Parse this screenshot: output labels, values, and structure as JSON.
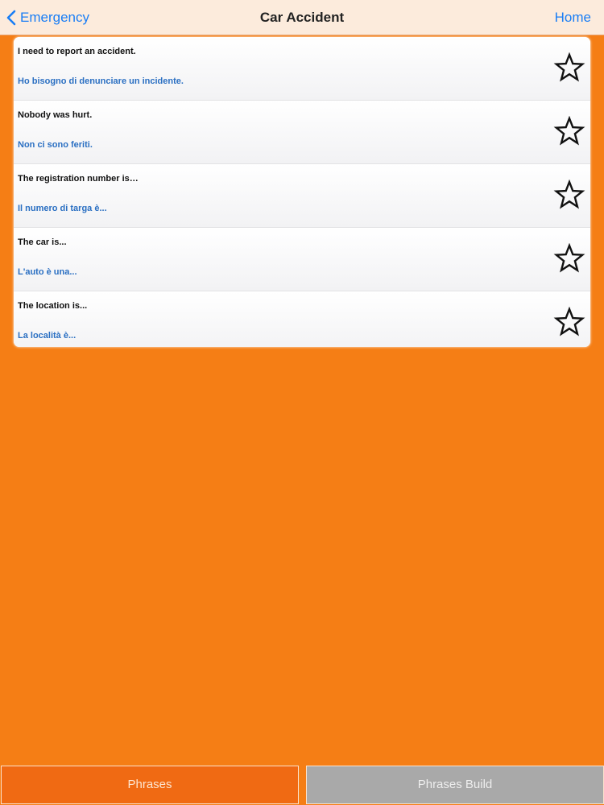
{
  "nav": {
    "back_label": "Emergency",
    "title": "Car Accident",
    "home_label": "Home"
  },
  "phrases": [
    {
      "english": "I need to report an accident.",
      "italian": "Ho bisogno di denunciare un incidente.",
      "starred": false
    },
    {
      "english": "Nobody was hurt.",
      "italian": "Non ci sono feriti.",
      "starred": false
    },
    {
      "english": "The registration number is…",
      "italian": "Il numero di targa è...",
      "starred": false
    },
    {
      "english": "The car is...",
      "italian": "L'auto è una...",
      "starred": false
    },
    {
      "english": "The location is...",
      "italian": "La località è...",
      "starred": false
    }
  ],
  "tabs": [
    {
      "label": "Phrases",
      "selected": true
    },
    {
      "label": "Phrases Build",
      "selected": false
    }
  ],
  "colors": {
    "background": "#f57e15",
    "nav_background": "#fcebdc",
    "link": "#1a7ef5",
    "italian_text": "#2a6fc2",
    "tab_selected": "#f06a13",
    "tab_unselected": "#a9a9a9"
  },
  "icons": {
    "back": "chevron-left-icon",
    "favorite": "star-outline-icon"
  }
}
